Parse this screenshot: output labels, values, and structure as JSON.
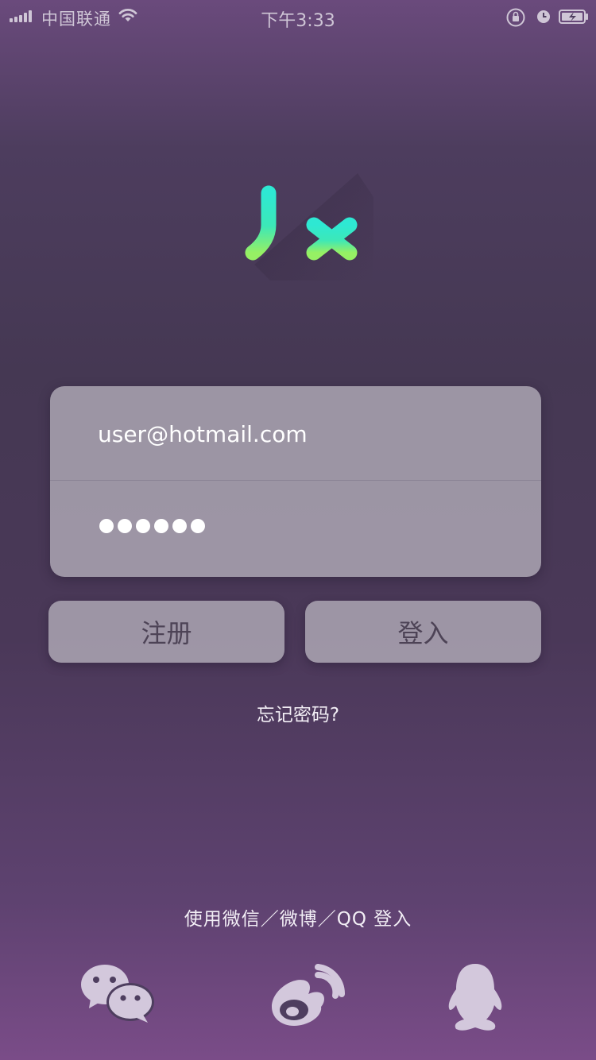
{
  "status_bar": {
    "carrier": "中国联通",
    "time": "下午3:33"
  },
  "login_form": {
    "email_value": "user@hotmail.com",
    "password_masked_length": 6
  },
  "buttons": {
    "register_label": "注册",
    "login_label": "登入"
  },
  "forgot_password_label": "忘记密码?",
  "social": {
    "caption": "使用微信／微博／QQ 登入",
    "icons": [
      "wechat-icon",
      "weibo-icon",
      "qq-icon"
    ]
  },
  "colors": {
    "logo_gradient_top": "#2de0c9",
    "logo_gradient_bottom": "#8cf06a",
    "card_fill": "#bebac4"
  }
}
